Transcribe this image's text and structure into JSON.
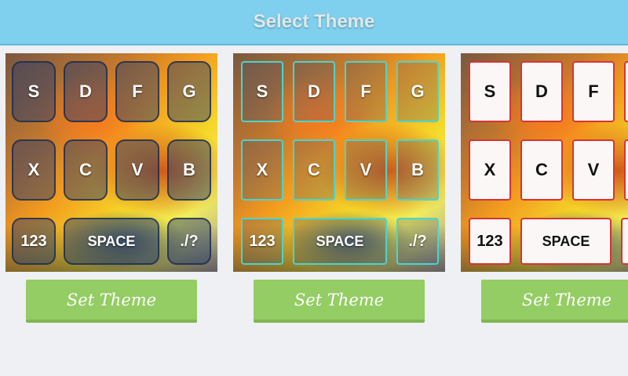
{
  "header": {
    "title": "Select Theme"
  },
  "keyboard": {
    "row1": [
      "S",
      "D",
      "F",
      "G"
    ],
    "row2": [
      "X",
      "C",
      "V",
      "B"
    ],
    "numbers": "123",
    "space": "SPACE",
    "punct": "./?"
  },
  "themes": [
    {
      "button_label": "Set Theme"
    },
    {
      "button_label": "Set Theme"
    },
    {
      "button_label": "Set Theme"
    }
  ],
  "colors": {
    "header_bg": "#7fd0ee",
    "button_bg": "#93cd63",
    "key_style_1": "#1e376e",
    "key_style_2": "#46d6d2",
    "key_style_3": "#d83434"
  }
}
